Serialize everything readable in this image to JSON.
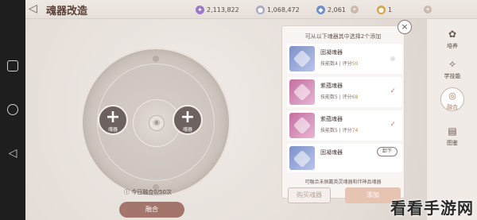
{
  "header": {
    "title": "魂器改造",
    "currencies": [
      {
        "icon": "purple-crystal-icon",
        "value": "2,113,822",
        "color": "#9a78c8"
      },
      {
        "icon": "silver-coin-icon",
        "value": "1,068,472",
        "color": "#a9a9c4"
      },
      {
        "icon": "blue-gem-icon",
        "value": "2,061",
        "color": "#6f8fc8"
      },
      {
        "icon": "gold-coin-icon",
        "value": "1",
        "color": "#d4a64a"
      }
    ]
  },
  "fusion": {
    "slot_left_label": "魂器",
    "slot_right_label": "魂器",
    "count_text": "今日融合0/50次",
    "fuse_button": "融合"
  },
  "panel": {
    "title": "可从以下魂器其中选择2个添加",
    "items": [
      {
        "name": "固凝魂器",
        "skill": "技能数4",
        "score_label": "评分",
        "score": "50",
        "color": "blue",
        "state": "none"
      },
      {
        "name": "紫蕴魂器",
        "skill": "技能数5",
        "score_label": "评分",
        "score": "68",
        "color": "pink",
        "state": "checked"
      },
      {
        "name": "紫蕴魂器",
        "skill": "技能数5",
        "score_label": "评分",
        "score": "74",
        "color": "pink",
        "state": "checked"
      },
      {
        "name": "固凝魂器",
        "skill": "",
        "score_label": "",
        "score": "",
        "color": "blue",
        "state": "unload",
        "unload_label": "卸下"
      }
    ],
    "footer": "可融合未佩戴英灵魂器和伴神品魂器",
    "buy_button": "购买魂器",
    "add_button": "添加"
  },
  "sidebar": {
    "items": [
      {
        "icon": "cultivate-icon",
        "label": "培养"
      },
      {
        "icon": "learn-skill-icon",
        "label": "学技能"
      },
      {
        "icon": "fusion-icon",
        "label": "融合"
      },
      {
        "icon": "atlas-icon",
        "label": "图鉴"
      }
    ]
  },
  "watermark": "看看手游网"
}
